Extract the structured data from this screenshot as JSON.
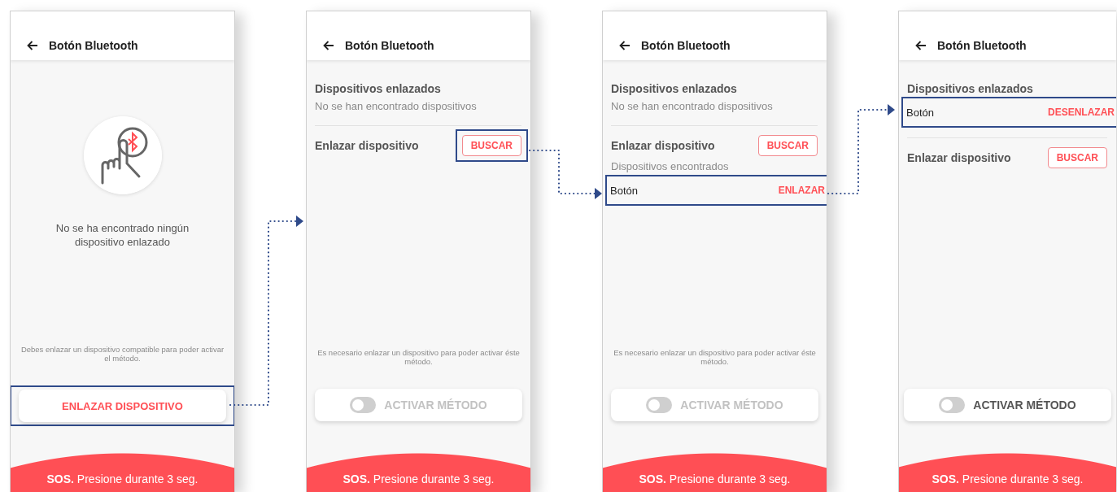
{
  "screens": [
    {
      "kind": "empty",
      "title": "Botón Bluetooth",
      "message": "No se ha encontrado ningún dispositivo enlazado",
      "hint": "Debes enlazar un dispositivo compatible para poder activar el método.",
      "action": {
        "label": "ENLAZAR DISPOSITIVO",
        "highlighted": true
      },
      "sos": "**SOS.** Presione durante 3 seg."
    },
    {
      "kind": "devices",
      "title": "Botón Bluetooth",
      "linked": {
        "heading": "Dispositivos enlazados",
        "empty_text": "No se han encontrado dispositivos"
      },
      "pair": {
        "heading": "Enlazar dispositivo",
        "search": {
          "label": "BUSCAR",
          "highlighted": true
        }
      },
      "hint": "Es necesario enlazar un dispositivo para poder activar éste método.",
      "toggle": {
        "label": "ACTIVAR MÉTODO",
        "on": false,
        "disabled": true
      },
      "sos": "**SOS.** Presione durante 3 seg."
    },
    {
      "kind": "devices",
      "title": "Botón Bluetooth",
      "linked": {
        "heading": "Dispositivos enlazados",
        "empty_text": "No se han encontrado dispositivos"
      },
      "pair": {
        "heading": "Enlazar dispositivo",
        "search": {
          "label": "BUSCAR",
          "highlighted": false
        },
        "found_heading": "Dispositivos encontrados",
        "devices": [
          {
            "name": "Botón",
            "action": "ENLAZAR",
            "highlighted": true
          }
        ]
      },
      "hint": "Es necesario enlazar un dispositivo para poder activar éste método.",
      "toggle": {
        "label": "ACTIVAR MÉTODO",
        "on": false,
        "disabled": true
      },
      "sos": "**SOS.** Presione durante 3 seg."
    },
    {
      "kind": "devices",
      "title": "Botón Bluetooth",
      "linked": {
        "heading": "Dispositivos enlazados",
        "devices": [
          {
            "name": "Botón",
            "action": "DESENLAZAR",
            "highlighted": true
          }
        ]
      },
      "pair": {
        "heading": "Enlazar dispositivo",
        "search": {
          "label": "BUSCAR",
          "highlighted": false
        }
      },
      "toggle": {
        "label": "ACTIVAR MÉTODO",
        "on": false,
        "disabled": false
      },
      "sos": "**SOS.** Presione durante 3 seg."
    }
  ]
}
